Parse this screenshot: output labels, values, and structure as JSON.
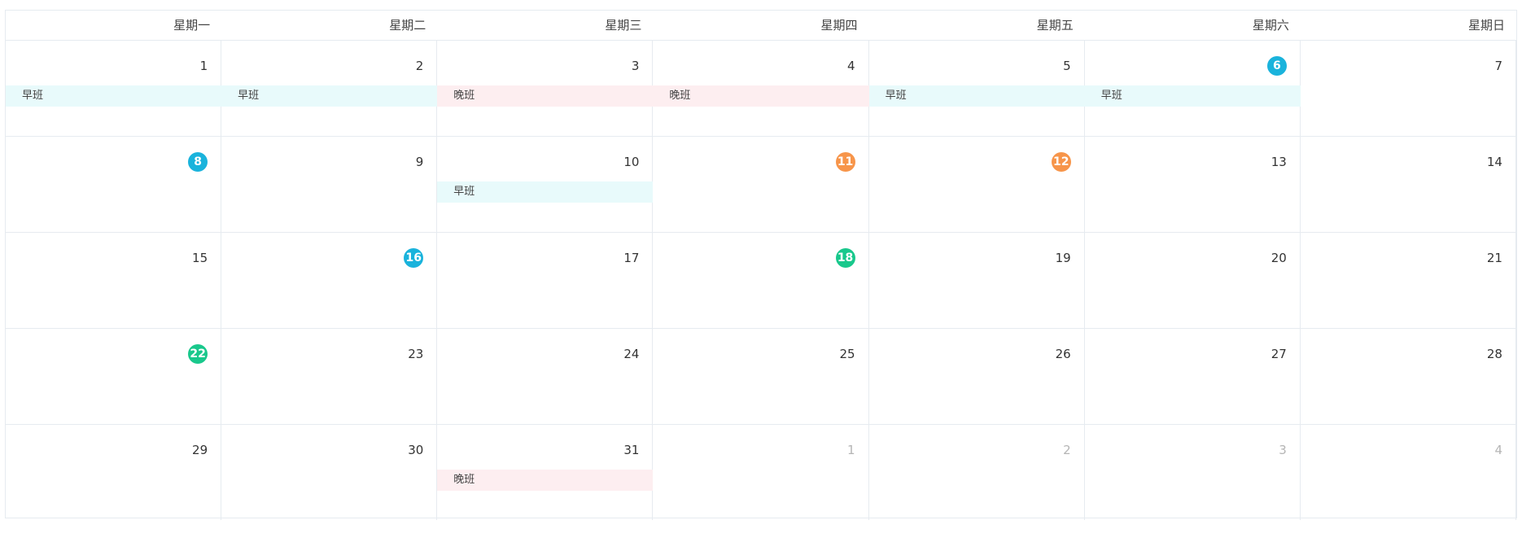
{
  "weekdays": [
    "星期一",
    "星期二",
    "星期三",
    "星期四",
    "星期五",
    "星期六",
    "星期日"
  ],
  "colors": {
    "today": "#1ab3dc",
    "orange": "#f7954a",
    "green": "#19c88c",
    "morning_shift_bg": "#e8fafb",
    "night_shift_bg": "#fdeef0"
  },
  "weeks": [
    {
      "days": [
        {
          "num": "1"
        },
        {
          "num": "2"
        },
        {
          "num": "3"
        },
        {
          "num": "4"
        },
        {
          "num": "5"
        },
        {
          "num": "6",
          "badge": "blue"
        },
        {
          "num": "7"
        }
      ],
      "events": [
        {
          "label": "早班",
          "type": "morning",
          "col": 0
        },
        {
          "label": "早班",
          "type": "morning",
          "col": 1
        },
        {
          "label": "晚班",
          "type": "night",
          "col": 2
        },
        {
          "label": "晚班",
          "type": "night",
          "col": 3
        },
        {
          "label": "早班",
          "type": "morning",
          "col": 4
        },
        {
          "label": "早班",
          "type": "morning",
          "col": 5
        }
      ]
    },
    {
      "days": [
        {
          "num": "8",
          "badge": "blue"
        },
        {
          "num": "9"
        },
        {
          "num": "10"
        },
        {
          "num": "11",
          "badge": "orange"
        },
        {
          "num": "12",
          "badge": "orange"
        },
        {
          "num": "13"
        },
        {
          "num": "14"
        }
      ],
      "events": [
        {
          "label": "早班",
          "type": "morning",
          "col": 2
        }
      ]
    },
    {
      "days": [
        {
          "num": "15"
        },
        {
          "num": "16",
          "badge": "blue"
        },
        {
          "num": "17"
        },
        {
          "num": "18",
          "badge": "green"
        },
        {
          "num": "19"
        },
        {
          "num": "20"
        },
        {
          "num": "21"
        }
      ],
      "events": []
    },
    {
      "days": [
        {
          "num": "22",
          "badge": "green"
        },
        {
          "num": "23"
        },
        {
          "num": "24"
        },
        {
          "num": "25"
        },
        {
          "num": "26"
        },
        {
          "num": "27"
        },
        {
          "num": "28"
        }
      ],
      "events": []
    },
    {
      "days": [
        {
          "num": "29"
        },
        {
          "num": "30"
        },
        {
          "num": "31"
        },
        {
          "num": "1",
          "other": true
        },
        {
          "num": "2",
          "other": true
        },
        {
          "num": "3",
          "other": true
        },
        {
          "num": "4",
          "other": true
        }
      ],
      "events": [
        {
          "label": "晚班",
          "type": "night",
          "col": 2
        }
      ]
    }
  ]
}
